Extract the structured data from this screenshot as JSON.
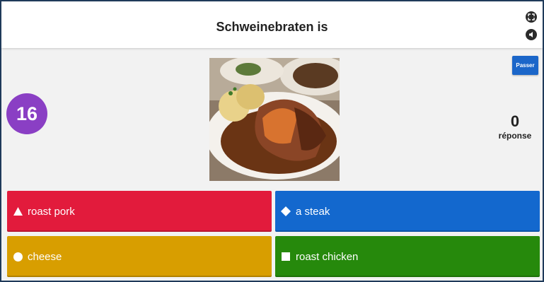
{
  "question": {
    "text": "Schweinebraten is"
  },
  "timer": {
    "value": "16"
  },
  "skip_button": {
    "label": "Passer"
  },
  "answers_count": {
    "value": "0",
    "label": "réponse"
  },
  "answers": [
    {
      "label": "roast pork",
      "shape": "triangle",
      "color": "#e21b3c"
    },
    {
      "label": "a steak",
      "shape": "diamond",
      "color": "#1368ce"
    },
    {
      "label": "cheese",
      "shape": "circle",
      "color": "#d89e00"
    },
    {
      "label": "roast chicken",
      "shape": "square",
      "color": "#26890c"
    }
  ],
  "icons": {
    "fullscreen": "expand-icon",
    "sound": "speaker-icon"
  },
  "colors": {
    "timer": "#8a3fc4",
    "skip_button": "#1b66c9"
  }
}
